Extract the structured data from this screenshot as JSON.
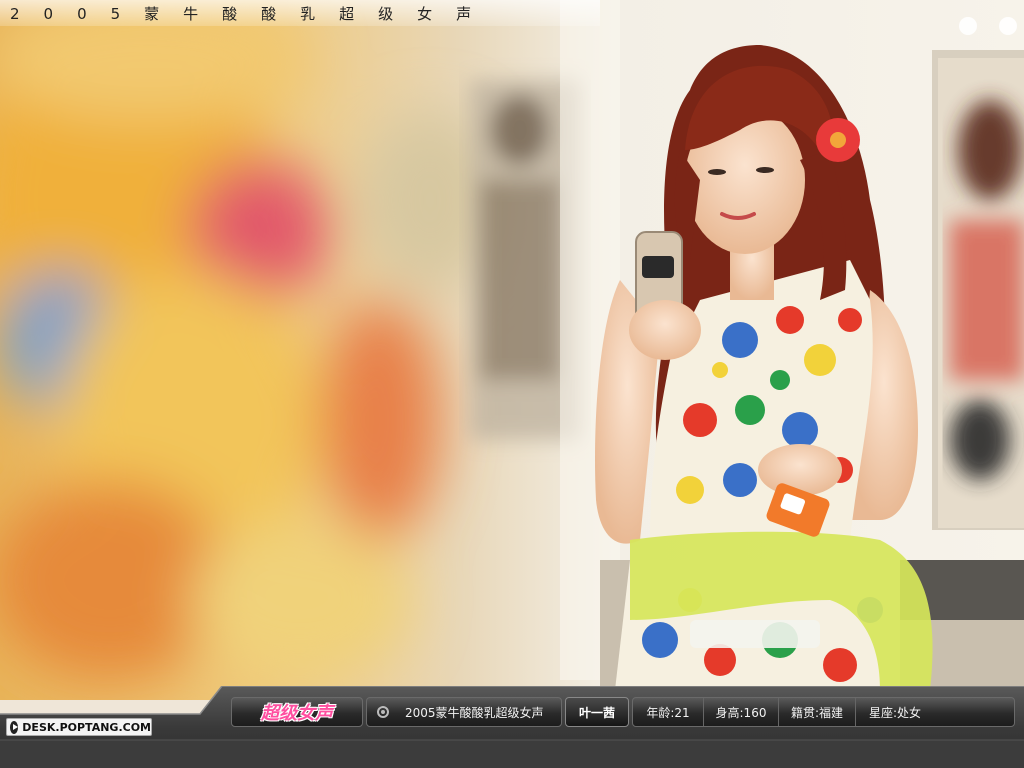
{
  "title": "2005蒙牛酸酸乳超级女声",
  "site": "DESK.POPTANG.COM",
  "logo_text": "超级女声",
  "event": "2005蒙牛酸酸乳超级女声",
  "name": "叶一茜",
  "stats": {
    "age": "年龄:21",
    "height": "身高:160",
    "hometown": "籍贯:福建",
    "zodiac": "星座:处女"
  },
  "colors": {
    "bar": "#2a2a2a",
    "logo": "#ff4fa0",
    "accent_flower": "#e83a3a",
    "sash": "#d8e85a"
  },
  "icons": [
    "play-icon",
    "target-icon"
  ]
}
